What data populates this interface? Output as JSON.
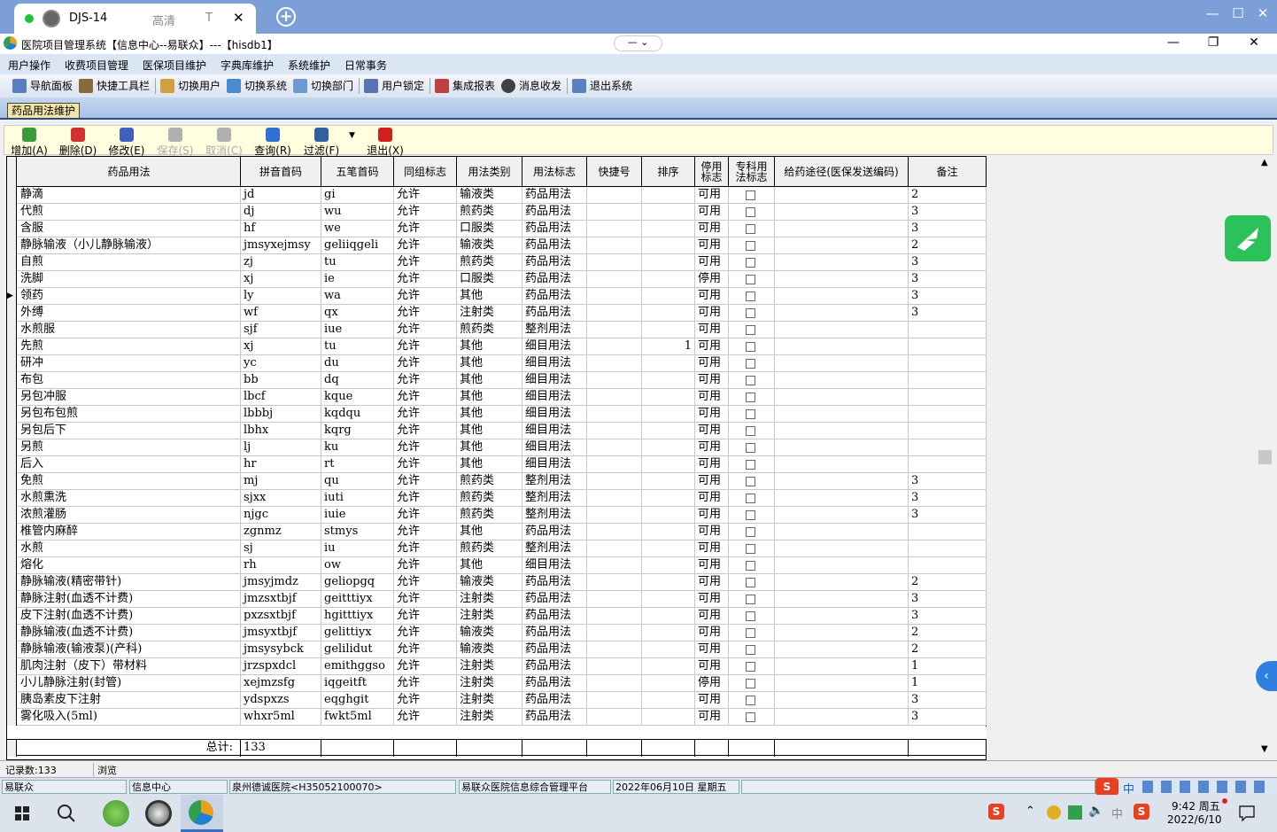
{
  "browser": {
    "tab_title": "DJS-14",
    "tab_quality": "高清",
    "tab_t": "T",
    "close_glyph": "✕",
    "new_tab_glyph": "+",
    "minimize": "—",
    "maximize": "☐",
    "close": "✕"
  },
  "app": {
    "title": "医院项目管理系统【信息中心--易联众】---【hisdb1】",
    "title_ctl": "—  ⌄",
    "minimize": "—",
    "restore": "❐",
    "close": "✕"
  },
  "menu": [
    "用户操作",
    "收费项目管理",
    "医保项目维护",
    "字典库维护",
    "系统维护",
    "日常事务"
  ],
  "toolbar": [
    "导航面板",
    "快捷工具栏",
    "切换用户",
    "切换系统",
    "切换部门",
    "用户锁定",
    "集成报表",
    "消息收发",
    "退出系统"
  ],
  "doc_tab": "药品用法维护",
  "actions": [
    {
      "label": "增加(A)",
      "enabled": true,
      "color": "#3a9a3a"
    },
    {
      "label": "删除(D)",
      "enabled": true,
      "color": "#d03030"
    },
    {
      "label": "修改(E)",
      "enabled": true,
      "color": "#4060c0"
    },
    {
      "label": "保存(S)",
      "enabled": false,
      "color": "#b0b0b0"
    },
    {
      "label": "取消(C)",
      "enabled": false,
      "color": "#b0b0b0"
    },
    {
      "label": "查询(R)",
      "enabled": true,
      "color": "#3070d0"
    },
    {
      "label": "过滤(F)",
      "enabled": true,
      "color": "#3060a0"
    },
    {
      "label": "退出(X)",
      "enabled": true,
      "color": "#d02020"
    }
  ],
  "filter_arrow": "▼",
  "grid": {
    "headers": [
      "药品用法",
      "拼音首码",
      "五笔首码",
      "同组标志",
      "用法类别",
      "用法标志",
      "快捷号",
      "排序",
      "停用标志",
      "专科用法标志",
      "给药途径(医保发送编码)",
      "备注"
    ],
    "rows": [
      [
        "静滴",
        "jd",
        "gi",
        "允许",
        "输液类",
        "药品用法",
        "",
        "",
        "可用",
        "",
        "",
        "2"
      ],
      [
        "代煎",
        "dj",
        "wu",
        "允许",
        "煎药类",
        "药品用法",
        "",
        "",
        "可用",
        "",
        "",
        "3"
      ],
      [
        "含服",
        "hf",
        "we",
        "允许",
        "口服类",
        "药品用法",
        "",
        "",
        "可用",
        "",
        "",
        "3"
      ],
      [
        "静脉输液（小儿静脉输液）",
        "jmsyxejmsy",
        "geliiqgeli",
        "允许",
        "输液类",
        "药品用法",
        "",
        "",
        "可用",
        "",
        "",
        "2"
      ],
      [
        "自煎",
        "zj",
        "tu",
        "允许",
        "煎药类",
        "药品用法",
        "",
        "",
        "可用",
        "",
        "",
        "3"
      ],
      [
        "洗脚",
        "xj",
        "ie",
        "允许",
        "口服类",
        "药品用法",
        "",
        "",
        "停用",
        "",
        "",
        "3"
      ],
      [
        "领药",
        "ly",
        "wa",
        "允许",
        "其他",
        "药品用法",
        "",
        "",
        "可用",
        "",
        "",
        "3"
      ],
      [
        "外缚",
        "wf",
        "qx",
        "允许",
        "注射类",
        "药品用法",
        "",
        "",
        "可用",
        "",
        "",
        "3"
      ],
      [
        "水煎服",
        "sjf",
        "iue",
        "允许",
        "煎药类",
        "整剂用法",
        "",
        "",
        "可用",
        "",
        "",
        ""
      ],
      [
        "先煎",
        "xj",
        "tu",
        "允许",
        "其他",
        "细目用法",
        "",
        "1",
        "可用",
        "",
        "",
        ""
      ],
      [
        "研冲",
        "yc",
        "du",
        "允许",
        "其他",
        "细目用法",
        "",
        "",
        "可用",
        "",
        "",
        ""
      ],
      [
        "布包",
        "bb",
        "dq",
        "允许",
        "其他",
        "细目用法",
        "",
        "",
        "可用",
        "",
        "",
        ""
      ],
      [
        "另包冲服",
        "lbcf",
        "kque",
        "允许",
        "其他",
        "细目用法",
        "",
        "",
        "可用",
        "",
        "",
        ""
      ],
      [
        "另包布包煎",
        "lbbbj",
        "kqdqu",
        "允许",
        "其他",
        "细目用法",
        "",
        "",
        "可用",
        "",
        "",
        ""
      ],
      [
        "另包后下",
        "lbhx",
        "kqrg",
        "允许",
        "其他",
        "细目用法",
        "",
        "",
        "可用",
        "",
        "",
        ""
      ],
      [
        "另煎",
        "lj",
        "ku",
        "允许",
        "其他",
        "细目用法",
        "",
        "",
        "可用",
        "",
        "",
        ""
      ],
      [
        "后入",
        "hr",
        "rt",
        "允许",
        "其他",
        "细目用法",
        "",
        "",
        "可用",
        "",
        "",
        ""
      ],
      [
        "免煎",
        "mj",
        "qu",
        "允许",
        "煎药类",
        "整剂用法",
        "",
        "",
        "可用",
        "",
        "",
        "3"
      ],
      [
        "水煎熏洗",
        "sjxx",
        "iuti",
        "允许",
        "煎药类",
        "整剂用法",
        "",
        "",
        "可用",
        "",
        "",
        "3"
      ],
      [
        "浓煎灌肠",
        "njgc",
        "iuie",
        "允许",
        "煎药类",
        "整剂用法",
        "",
        "",
        "可用",
        "",
        "",
        "3"
      ],
      [
        "椎管内麻醉",
        "zgnmz",
        "stmys",
        "允许",
        "其他",
        "药品用法",
        "",
        "",
        "可用",
        "",
        "",
        ""
      ],
      [
        "水煎",
        "sj",
        "iu",
        "允许",
        "煎药类",
        "整剂用法",
        "",
        "",
        "可用",
        "",
        "",
        ""
      ],
      [
        "熔化",
        "rh",
        "ow",
        "允许",
        "其他",
        "细目用法",
        "",
        "",
        "可用",
        "",
        "",
        ""
      ],
      [
        "静脉输液(精密带针)",
        "jmsyjmdz",
        "geliopgq",
        "允许",
        "输液类",
        "药品用法",
        "",
        "",
        "可用",
        "",
        "",
        "2"
      ],
      [
        "静脉注射(血透不计费)",
        "jmzsxtbjf",
        "geitttiyx",
        "允许",
        "注射类",
        "药品用法",
        "",
        "",
        "可用",
        "",
        "",
        "3"
      ],
      [
        "皮下注射(血透不计费)",
        "pxzsxtbjf",
        "hgitttiyx",
        "允许",
        "注射类",
        "药品用法",
        "",
        "",
        "可用",
        "",
        "",
        "3"
      ],
      [
        "静脉输液(血透不计费)",
        "jmsyxtbjf",
        "gelittiyx",
        "允许",
        "输液类",
        "药品用法",
        "",
        "",
        "可用",
        "",
        "",
        "2"
      ],
      [
        "静脉输液(输液泵)(产科)",
        "jmsysybck",
        "gelilidut",
        "允许",
        "输液类",
        "药品用法",
        "",
        "",
        "可用",
        "",
        "",
        "2"
      ],
      [
        "肌肉注射（皮下）带材料",
        "jrzspxdcl",
        "emithggso",
        "允许",
        "注射类",
        "药品用法",
        "",
        "",
        "可用",
        "",
        "",
        "1"
      ],
      [
        "小儿静脉注射(封管)",
        "xejmzsfg",
        "iqgeitft",
        "允许",
        "注射类",
        "药品用法",
        "",
        "",
        "停用",
        "",
        "",
        "1"
      ],
      [
        "胰岛素皮下注射",
        "ydspxzs",
        "eqghgit",
        "允许",
        "注射类",
        "药品用法",
        "",
        "",
        "可用",
        "",
        "",
        "3"
      ],
      [
        "雾化吸入(5ml)",
        "whxr5ml",
        "fwkt5ml",
        "允许",
        "注射类",
        "药品用法",
        "",
        "",
        "可用",
        "",
        "",
        "3"
      ]
    ],
    "current_row": 6,
    "total_label": "总计:",
    "total_value": "133"
  },
  "status": {
    "records": "记录数:133",
    "mode": "浏览"
  },
  "app_status": [
    "易联众",
    "信息中心",
    "泉州德诚医院<H35052100070>",
    "易联众医院信息综合管理平台",
    "2022年06月10日  星期五"
  ],
  "taskbar": {
    "time": "9:42 周五",
    "date": "2022/6/10",
    "ime": "中"
  }
}
